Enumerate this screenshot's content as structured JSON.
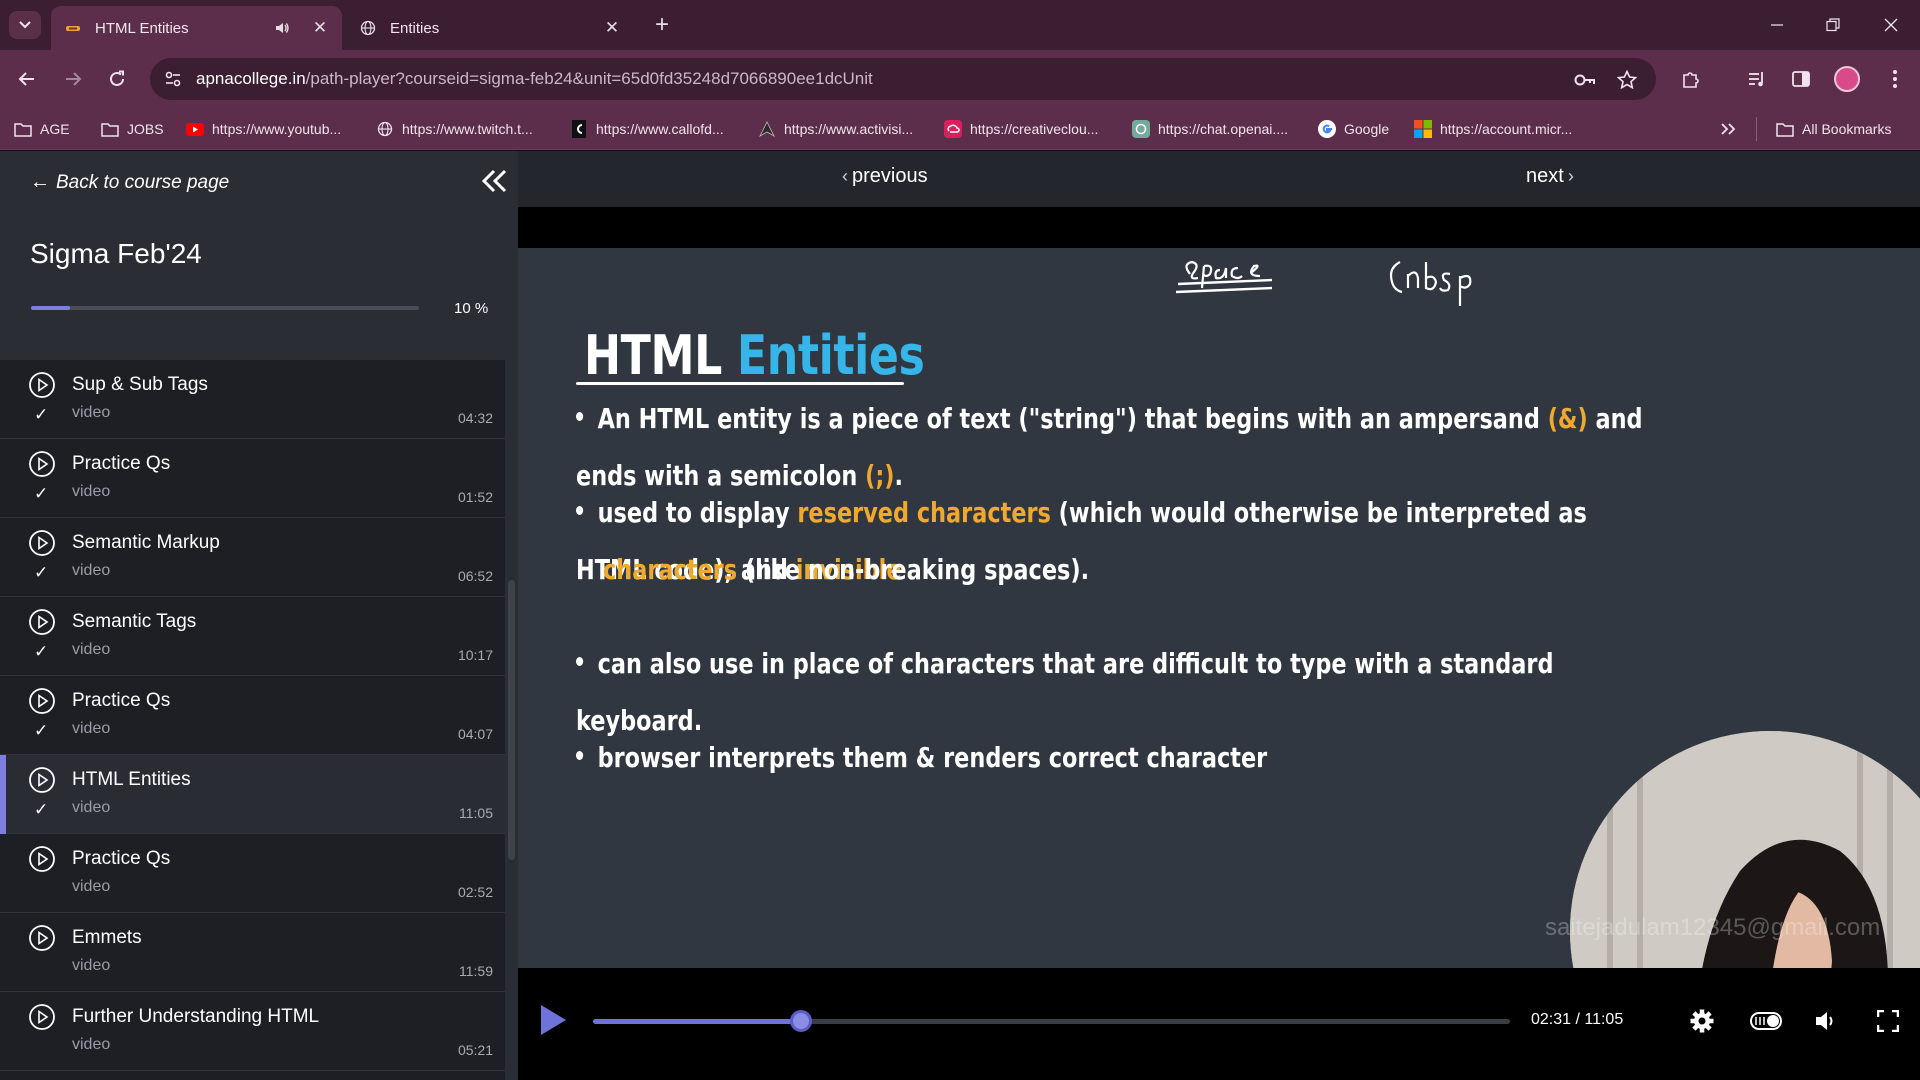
{
  "browser": {
    "tabs": [
      {
        "title": "HTML Entities",
        "active": true,
        "playing_audio": true
      },
      {
        "title": "Entities",
        "active": false
      }
    ],
    "url_host": "apnacollege.in",
    "url_path": "/path-player?courseid=sigma-feb24&unit=65d0fd35248d7066890ee1dcUnit",
    "bookmarks": [
      {
        "label": "AGE",
        "icon": "folder-icon"
      },
      {
        "label": "JOBS",
        "icon": "folder-icon"
      },
      {
        "label": "https://www.youtub...",
        "icon": "youtube-icon"
      },
      {
        "label": "https://www.twitch.t...",
        "icon": "globe-icon"
      },
      {
        "label": "https://www.callofd...",
        "icon": "callofduty-icon"
      },
      {
        "label": "https://www.activisi...",
        "icon": "activision-icon"
      },
      {
        "label": "https://creativeclou...",
        "icon": "creativecloud-icon"
      },
      {
        "label": "https://chat.openai....",
        "icon": "openai-icon"
      },
      {
        "label": "Google",
        "icon": "google-icon"
      },
      {
        "label": "https://account.micr...",
        "icon": "microsoft-icon"
      }
    ],
    "all_bookmarks_label": "All Bookmarks"
  },
  "sidebar": {
    "back_label": "Back to course page",
    "course_title": "Sigma Feb'24",
    "progress": 0.1,
    "progress_label": "10 %",
    "lessons": [
      {
        "title": "Sup & Sub Tags",
        "type": "video",
        "duration": "04:32",
        "completed": true,
        "active": false
      },
      {
        "title": "Practice Qs",
        "type": "video",
        "duration": "01:52",
        "completed": true,
        "active": false
      },
      {
        "title": "Semantic Markup",
        "type": "video",
        "duration": "06:52",
        "completed": true,
        "active": false
      },
      {
        "title": "Semantic Tags",
        "type": "video",
        "duration": "10:17",
        "completed": true,
        "active": false
      },
      {
        "title": "Practice Qs",
        "type": "video",
        "duration": "04:07",
        "completed": true,
        "active": false
      },
      {
        "title": "HTML Entities",
        "type": "video",
        "duration": "11:05",
        "completed": true,
        "active": true
      },
      {
        "title": "Practice Qs",
        "type": "video",
        "duration": "02:52",
        "completed": false,
        "active": false
      },
      {
        "title": "Emmets",
        "type": "video",
        "duration": "11:59",
        "completed": false,
        "active": false
      },
      {
        "title": "Further Understanding HTML",
        "type": "video",
        "duration": "05:21",
        "completed": false,
        "active": false
      }
    ]
  },
  "player": {
    "previous_label": "previous",
    "next_label": "next",
    "slide": {
      "title_plain": "HTML ",
      "title_accent": "Entities",
      "bullet1_a": "An HTML entity is a piece of text (\"string\") that begins with an ampersand ",
      "bullet1_hl1": "(&)",
      "bullet1_b": " and ends with a semicolon ",
      "bullet1_hl2": "(;)",
      "bullet1_c": ".",
      "bullet2_a": "used to display ",
      "bullet2_hl1": "reserved characters",
      "bullet2_b": " (which would otherwise be interpreted as HTML code), and ",
      "bullet2_hl2": "invisible",
      "bullet2_hl3": "characters",
      "bullet2_c": " (like non-breaking spaces).",
      "bullet3": "can also use in place of characters that are difficult to type with a standard keyboard.",
      "bullet4": "browser interprets them & renders correct character",
      "watermark": "saitejadulam12345@gmail.com"
    },
    "playback_progress": 0.227,
    "time_label": "02:31 / 11:05",
    "colors": {
      "accent": "#37b4e8",
      "highlight": "#f0a92e",
      "progress": "#6f72d8"
    }
  }
}
